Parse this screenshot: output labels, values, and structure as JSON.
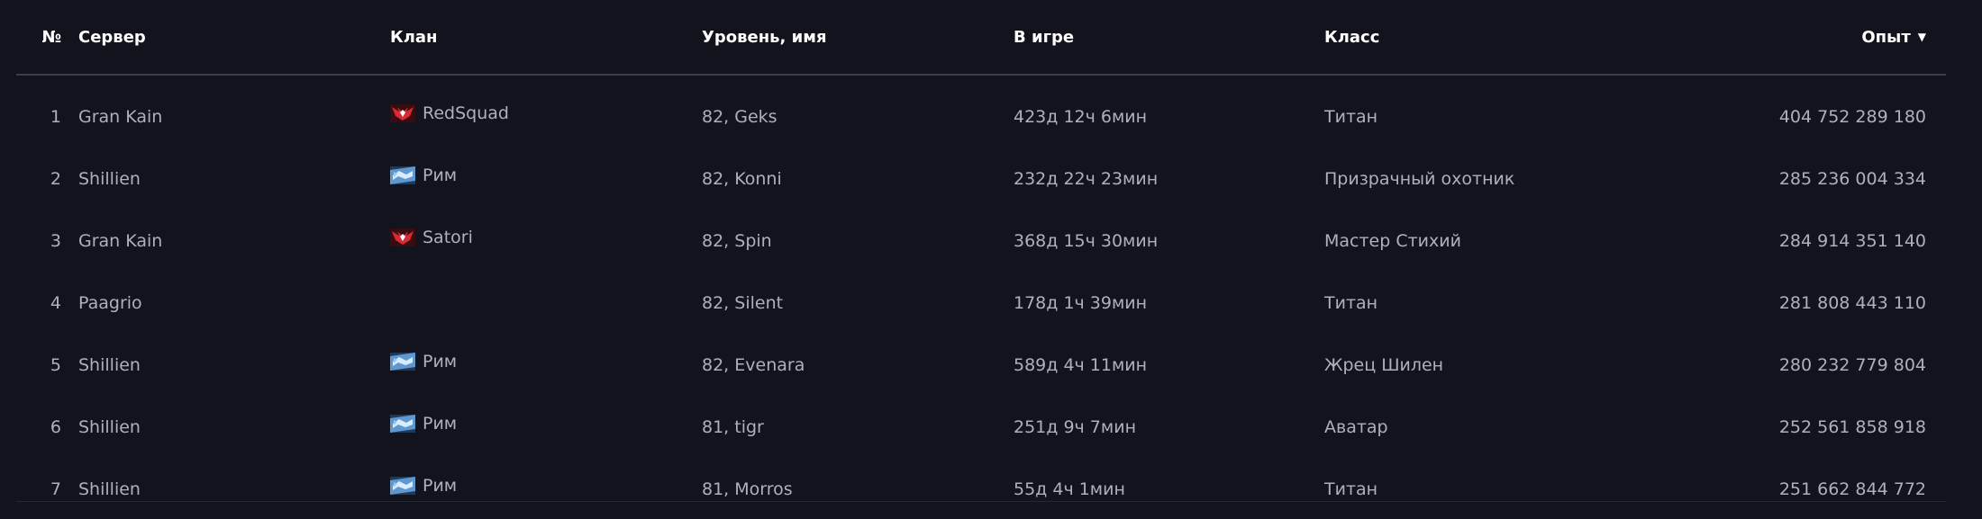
{
  "table": {
    "headers": {
      "num": "№",
      "server": "Сервер",
      "clan": "Клан",
      "level": "Уровень, имя",
      "time": "В игре",
      "class": "Класс",
      "exp": "Опыт"
    },
    "sort": {
      "column": "exp",
      "direction": "desc",
      "icon": "triangle-down-icon"
    },
    "rows": [
      {
        "num": "1",
        "server": "Gran Kain",
        "clan": "RedSquad",
        "clan_crest": "red-winged-crest-icon",
        "level": "82, Geks",
        "time": "423д 12ч 6мин",
        "class": "Титан",
        "exp": "404 752 289 180"
      },
      {
        "num": "2",
        "server": "Shillien",
        "clan": "Рим",
        "clan_crest": "blue-banner-crest-icon",
        "level": "82, Konni",
        "time": "232д 22ч 23мин",
        "class": "Призрачный охотник",
        "exp": "285 236 004 334"
      },
      {
        "num": "3",
        "server": "Gran Kain",
        "clan": "Satori",
        "clan_crest": "red-winged-crest-icon",
        "level": "82, Spin",
        "time": "368д 15ч 30мин",
        "class": "Мастер Стихий",
        "exp": "284 914 351 140"
      },
      {
        "num": "4",
        "server": "Paagrio",
        "clan": "",
        "clan_crest": "",
        "level": "82, Silent",
        "time": "178д 1ч 39мин",
        "class": "Титан",
        "exp": "281 808 443 110"
      },
      {
        "num": "5",
        "server": "Shillien",
        "clan": "Рим",
        "clan_crest": "blue-banner-crest-icon",
        "level": "82, Evenara",
        "time": "589д 4ч 11мин",
        "class": "Жрец Шилен",
        "exp": "280 232 779 804"
      },
      {
        "num": "6",
        "server": "Shillien",
        "clan": "Рим",
        "clan_crest": "blue-banner-crest-icon",
        "level": "81, tigr",
        "time": "251д 9ч 7мин",
        "class": "Аватар",
        "exp": "252 561 858 918"
      },
      {
        "num": "7",
        "server": "Shillien",
        "clan": "Рим",
        "clan_crest": "blue-banner-crest-icon",
        "level": "81, Morros",
        "time": "55д 4ч 1мин",
        "class": "Титан",
        "exp": "251 662 844 772"
      }
    ]
  },
  "colors": {
    "background": "#12131c",
    "header_text": "#ffffff",
    "body_text": "#aeb1bd",
    "divider": "#3b3d49",
    "crest_red": "#c8202c",
    "crest_blue": "#6aa3d8"
  }
}
